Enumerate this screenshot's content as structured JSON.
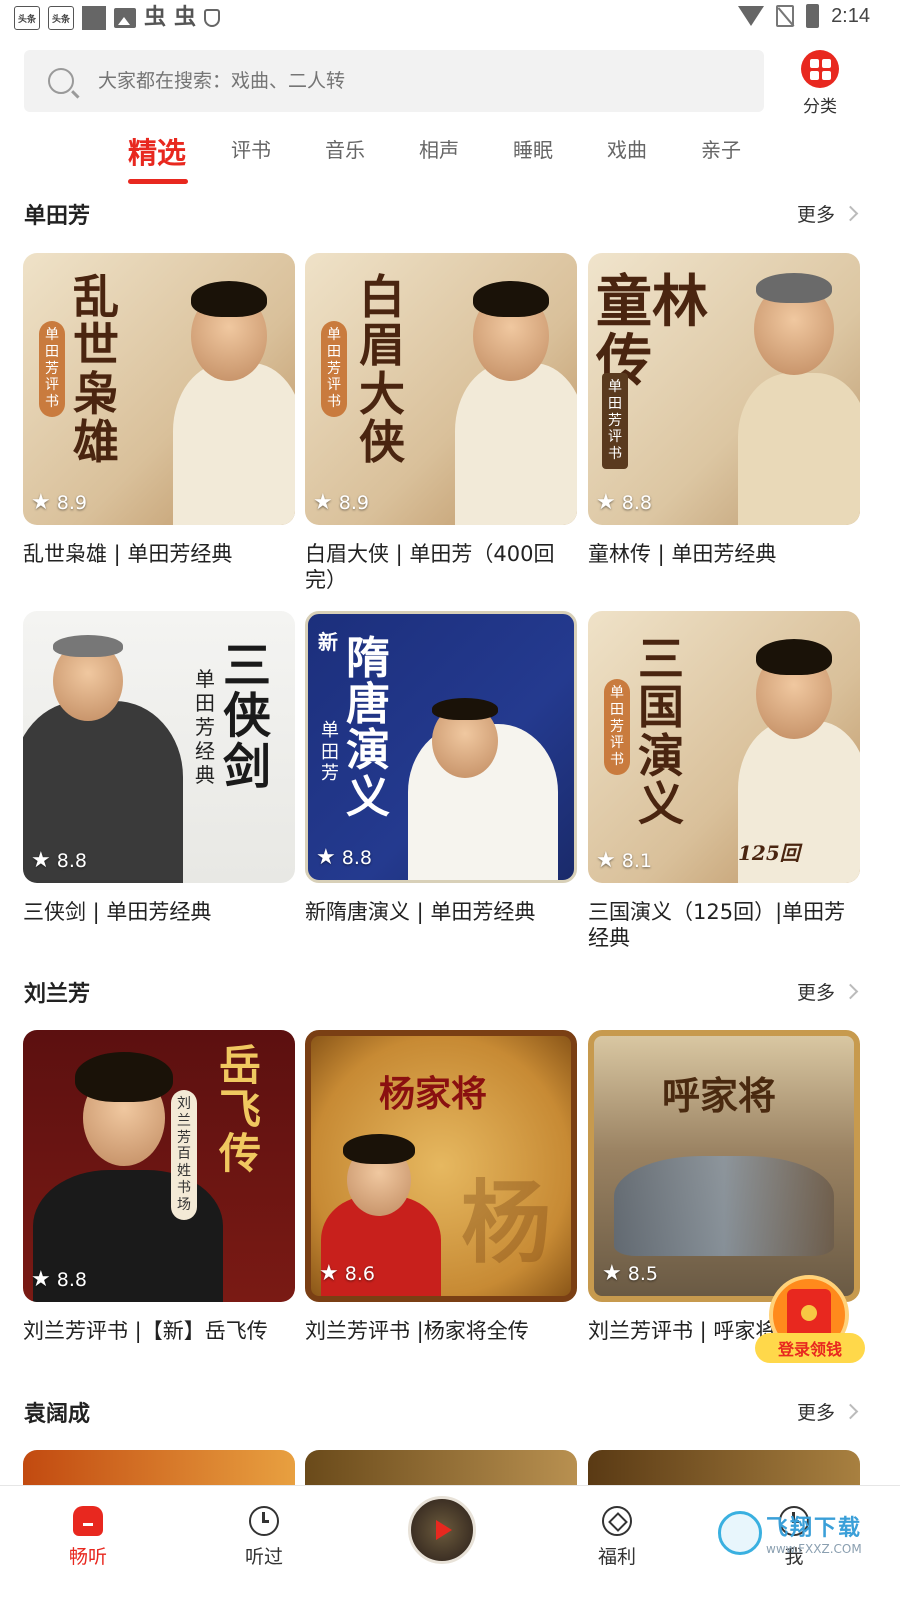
{
  "status_bar": {
    "app_icon_labels": [
      "头条",
      "头条"
    ],
    "time": "2:14"
  },
  "search": {
    "placeholder": "大家都在搜索：戏曲、二人转"
  },
  "category_button": {
    "label": "分类"
  },
  "tabs": [
    {
      "label": "精选",
      "active": true
    },
    {
      "label": "评书"
    },
    {
      "label": "音乐"
    },
    {
      "label": "相声"
    },
    {
      "label": "睡眠"
    },
    {
      "label": "戏曲"
    },
    {
      "label": "亲子"
    }
  ],
  "more_label": "更多",
  "sections": [
    {
      "title": "单田芳",
      "cards": [
        {
          "cover_text": "乱世枭雄",
          "badge": "单田芳评书",
          "rating": "8.9",
          "title": "乱世枭雄 | 单田芳经典"
        },
        {
          "cover_text": "白眉大侠",
          "badge": "单田芳评书",
          "rating": "8.9",
          "title": "白眉大侠 | 单田芳（400回完）"
        },
        {
          "cover_text": "童林传",
          "badge": "单田芳评书",
          "rating": "8.8",
          "title": "童林传 | 单田芳经典"
        },
        {
          "cover_text": "三侠剑",
          "badge": "单田芳经典",
          "rating": "8.8",
          "title": "三侠剑 | 单田芳经典"
        },
        {
          "cover_text": "隋唐演义",
          "cover_prefix": "新",
          "badge": "单田芳",
          "rating": "8.8",
          "title": "新隋唐演义 | 单田芳经典"
        },
        {
          "cover_text": "三国演义",
          "badge": "单田芳评书",
          "cover_note": "125回",
          "rating": "8.1",
          "title": "三国演义（125回）|单田芳经典"
        }
      ]
    },
    {
      "title": "刘兰芳",
      "cards": [
        {
          "cover_text": "岳飞传",
          "badge": "刘兰芳百姓书场",
          "rating": "8.8",
          "title": "刘兰芳评书 |【新】岳飞传"
        },
        {
          "cover_text": "杨家将",
          "cover_note": "杨",
          "rating": "8.6",
          "title": "刘兰芳评书 |杨家将全传"
        },
        {
          "cover_text": "呼家将",
          "rating": "8.5",
          "title": "刘兰芳评书 | 呼家将"
        }
      ]
    },
    {
      "title": "袁阔成"
    }
  ],
  "floating_envelope": {
    "label": "登录领钱"
  },
  "bottom_nav": [
    {
      "label": "畅听",
      "active": true
    },
    {
      "label": "听过"
    },
    {
      "label": "福利"
    },
    {
      "label": "我"
    }
  ],
  "watermark": {
    "cn": "飞翔下载",
    "en": "www.FXXZ.COM"
  },
  "colors": {
    "accent": "#e8281f",
    "envelope": "#ff8a1c"
  }
}
